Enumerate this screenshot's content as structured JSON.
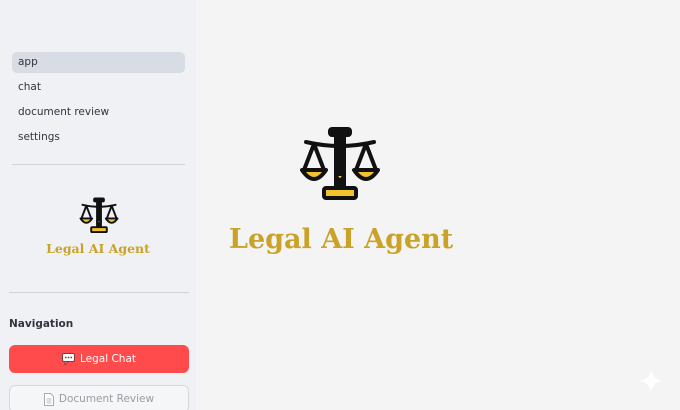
{
  "sidebar": {
    "pages": [
      {
        "label": "app",
        "active": true
      },
      {
        "label": "chat",
        "active": false
      },
      {
        "label": "document review",
        "active": false
      },
      {
        "label": "settings",
        "active": false
      }
    ],
    "brand_title": "Legal AI Agent",
    "nav_heading": "Navigation",
    "buttons": {
      "chat_label": "Legal Chat",
      "doc_label": "Document Review"
    }
  },
  "main": {
    "title": "Legal AI Agent"
  },
  "icons": {
    "brand": "scales-icon",
    "chat": "speech-bubble-icon",
    "doc": "document-icon",
    "corner": "sparkle-icon"
  },
  "colors": {
    "accent": "#c9a227",
    "primary_button": "#ff4b4b",
    "active_nav": "#d8dce5"
  }
}
